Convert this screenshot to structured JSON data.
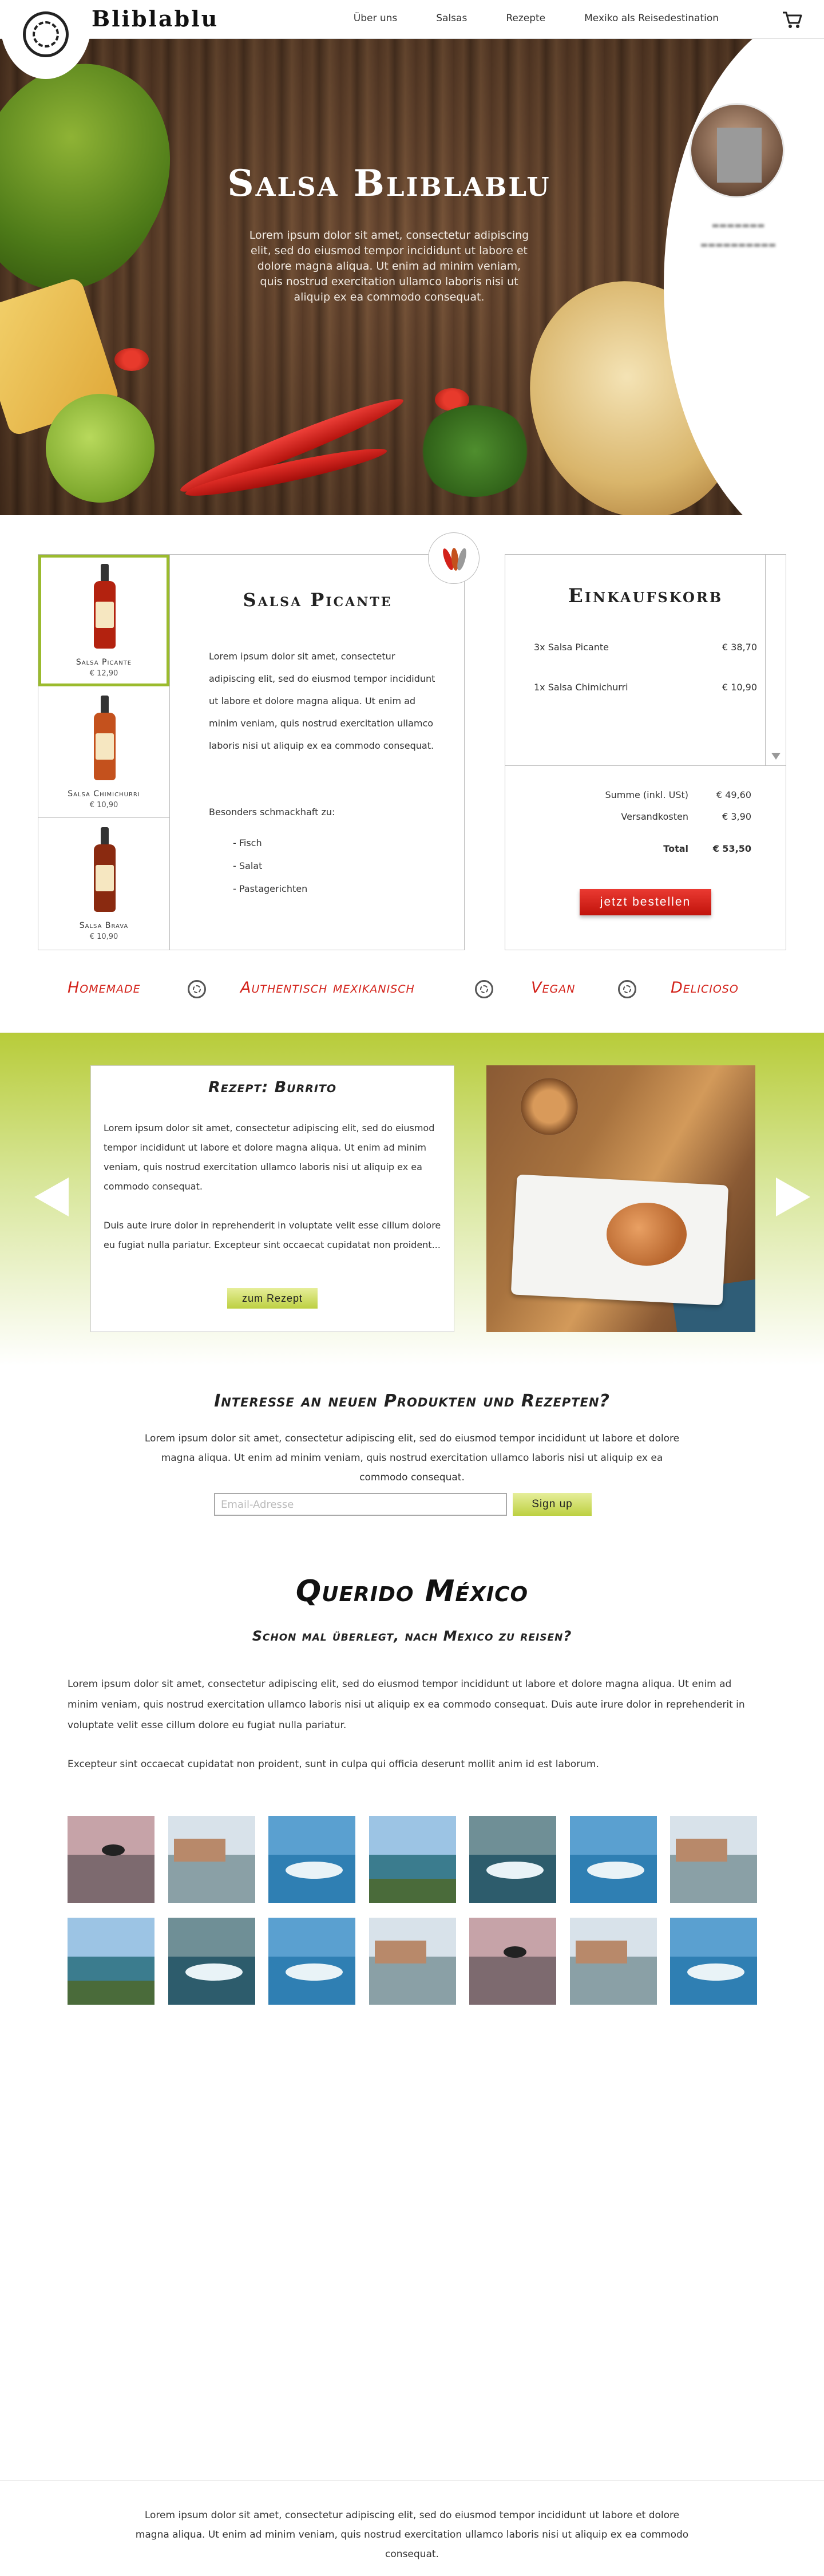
{
  "header": {
    "brand": "Bliblablu",
    "nav": [
      "Über uns",
      "Salsas",
      "Rezepte",
      "Mexiko als Reisedestination"
    ],
    "cart_icon": "cart-icon",
    "logo_icon": "aztec-logo-icon"
  },
  "hero": {
    "title": "Salsa Bliblablu",
    "text": "Lorem ipsum dolor sit amet, consectetur adipiscing elit, sed do eiusmod tempor incididunt ut labore et dolore magna aliqua. Ut enim ad minim veniam, quis nostrud exercitation ullamco laboris nisi ut aliquip ex ea commodo consequat."
  },
  "products": {
    "items": [
      {
        "name": "Salsa Picante",
        "price": "€ 12,90",
        "color": "#b3220f",
        "selected": true
      },
      {
        "name": "Salsa Chimichurri",
        "price": "€ 10,90",
        "color": "#c4511d",
        "selected": false
      },
      {
        "name": "Salsa Brava",
        "price": "€ 10,90",
        "color": "#8a2a10",
        "selected": false
      }
    ],
    "detail_title": "Salsa Picante",
    "detail_text": "Lorem ipsum dolor sit amet, consectetur adipiscing elit, sed do eiusmod tempor incididunt ut labore et dolore magna aliqua. Ut enim ad minim veniam, quis nostrud exercitation ullamco laboris nisi ut aliquip ex ea commodo consequat.",
    "special_label": "Besonders schmackhaft zu:",
    "pairings": [
      "- Fisch",
      "- Salat",
      "- Pastagerichten"
    ],
    "badge_icon": "chili-peppers-icon"
  },
  "cart": {
    "title": "Einkaufskorb",
    "items": [
      {
        "label": "3x  Salsa Picante",
        "price": "€ 38,70"
      },
      {
        "label": "1x  Salsa Chimichurri",
        "price": "€ 10,90"
      }
    ],
    "subtotal_label": "Summe (inkl. USt)",
    "subtotal": "€ 49,60",
    "shipping_label": "Versandkosten",
    "shipping": "€ 3,90",
    "total_label": "Total",
    "total": "€ 53,50",
    "order_label": "jetzt bestellen"
  },
  "features": [
    "Homemade",
    "Authentisch mexikanisch",
    "Vegan",
    "Delicioso"
  ],
  "recipe": {
    "title": "Rezept: Burrito",
    "text1": "Lorem ipsum dolor sit amet, consectetur adipiscing elit, sed do eiusmod tempor incididunt ut labore et dolore magna aliqua. Ut enim ad minim veniam, quis nostrud exercitation ullamco laboris nisi ut aliquip ex ea commodo consequat.",
    "text2": "Duis aute irure dolor in reprehenderit in voluptate velit esse cillum dolore eu fugiat nulla pariatur. Excepteur sint occaecat cupidatat non proident...",
    "button": "zum Rezept"
  },
  "newsletter": {
    "title": "Interesse an neuen Produkten und Rezepten?",
    "text": "Lorem ipsum dolor sit amet, consectetur adipiscing elit, sed do eiusmod tempor incididunt ut labore et dolore magna aliqua. Ut enim ad minim veniam, quis nostrud exercitation ullamco laboris nisi ut aliquip ex ea commodo consequat.",
    "placeholder": "Email-Adresse",
    "button": "Sign up"
  },
  "mexico": {
    "title": "Querido México",
    "subtitle": "Schon mal überlegt, nach Mexico zu reisen?",
    "text1": "Lorem ipsum dolor sit amet, consectetur adipiscing elit, sed do eiusmod tempor incididunt ut labore et dolore magna aliqua. Ut enim ad minim veniam, quis nostrud exercitation ullamco laboris nisi ut aliquip ex ea commodo consequat. Duis aute irure dolor in reprehenderit in voluptate velit esse cillum dolore eu fugiat nulla pariatur.",
    "text2": "Excepteur sint occaecat cupidatat non proident, sunt in culpa qui officia deserunt mollit anim id est laborum.",
    "gallery": [
      "paragliding",
      "coastal-town",
      "jetski",
      "lagoon",
      "boat-wake",
      "jetski",
      "coastal-town",
      "lagoon",
      "boat-wake",
      "jetski",
      "coastal-town",
      "paragliding",
      "coastal-town",
      "jetski"
    ]
  },
  "footer": {
    "text": "Lorem ipsum dolor sit amet, consectetur adipiscing elit, sed do eiusmod tempor incididunt ut labore et dolore magna aliqua. Ut enim ad minim veniam, quis nostrud exercitation ullamco laboris nisi ut aliquip ex ea commodo consequat."
  },
  "colors": {
    "accent_red": "#d3221a",
    "accent_green": "#b8cc3a",
    "selected_outline": "#9bbb2d"
  }
}
